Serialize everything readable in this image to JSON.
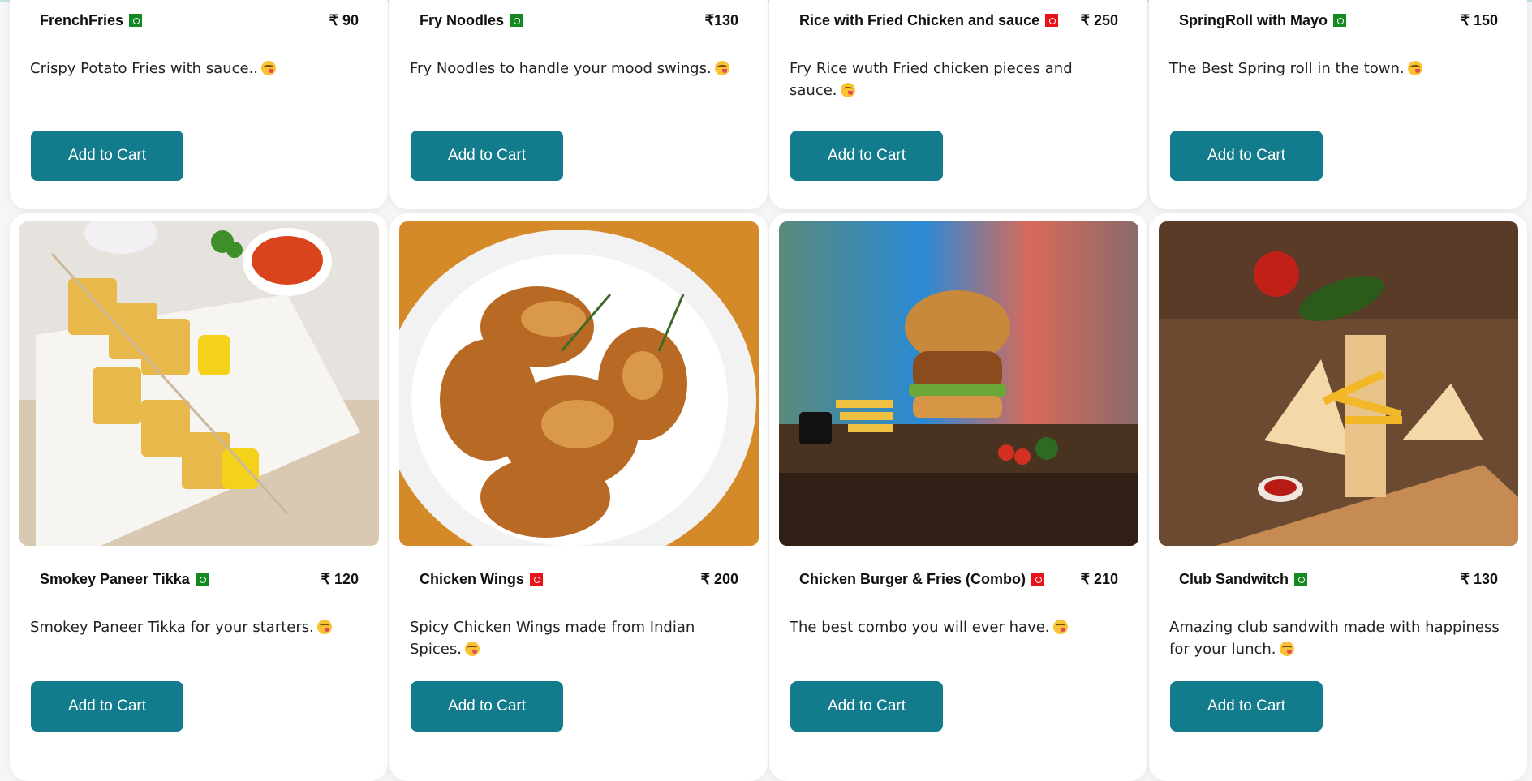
{
  "colors": {
    "button_bg": "#127b8c",
    "veg_mark": "#138a21",
    "nonveg_mark": "#e8131a"
  },
  "button_label": "Add to Cart",
  "items_row1": [
    {
      "name": "FrenchFries",
      "type": "veg",
      "price": "₹ 90",
      "description": "Crispy Potato Fries with sauce.."
    },
    {
      "name": "Fry Noodles",
      "type": "veg",
      "price": "₹130",
      "description": "Fry Noodles to handle your mood swings."
    },
    {
      "name": "Rice with Fried Chicken and sauce",
      "type": "non-veg",
      "price": "₹ 250",
      "description": "Fry Rice wuth Fried chicken pieces and sauce."
    },
    {
      "name": "SpringRoll with Mayo",
      "type": "veg",
      "price": "₹ 150",
      "description": "The Best Spring roll in the town."
    }
  ],
  "items_row2": [
    {
      "name": "Smokey Paneer Tikka",
      "type": "veg",
      "price": "₹ 120",
      "description": "Smokey Paneer Tikka for your starters."
    },
    {
      "name": "Chicken Wings",
      "type": "non-veg",
      "price": "₹ 200",
      "description": "Spicy Chicken Wings made from Indian Spices."
    },
    {
      "name": "Chicken Burger & Fries (Combo)",
      "type": "non-veg",
      "price": "₹ 210",
      "description": "The best combo you will ever have."
    },
    {
      "name": "Club Sandwitch",
      "type": "veg",
      "price": "₹ 130",
      "description": "Amazing club sandwith made with happiness for your lunch."
    }
  ]
}
